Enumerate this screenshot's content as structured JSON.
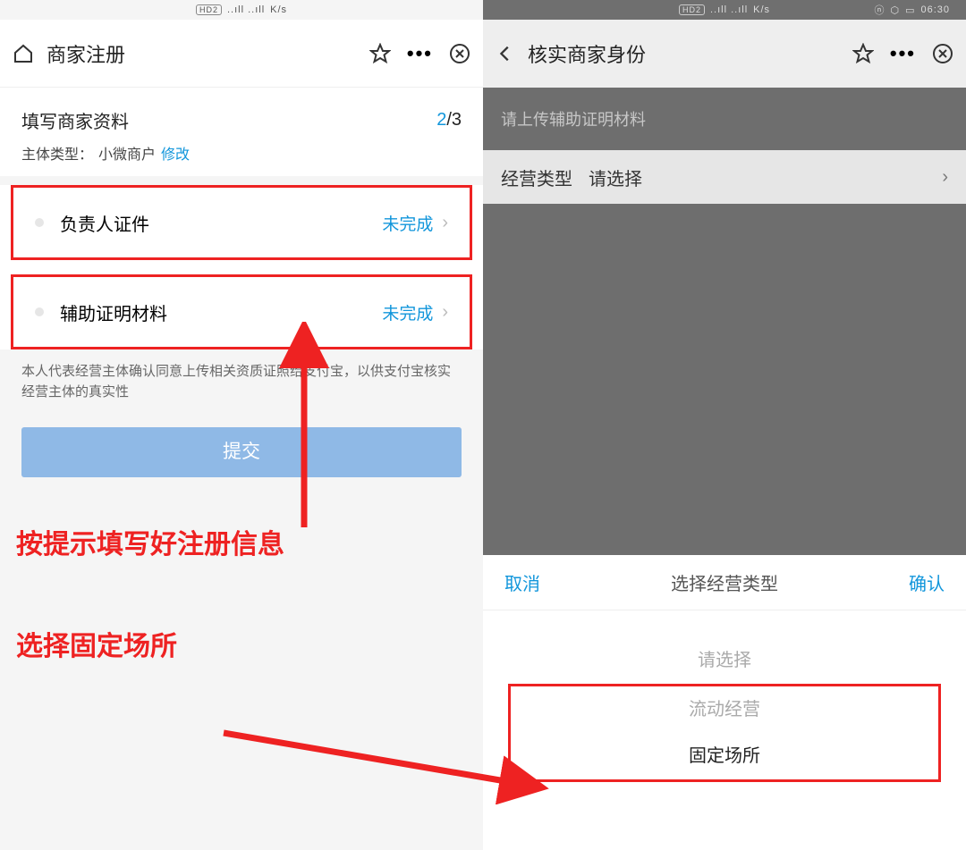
{
  "left": {
    "status": {
      "hd": "HD2",
      "signal": "",
      "speed": "K/s"
    },
    "titlebar": {
      "title": "商家注册"
    },
    "section": {
      "title": "填写商家资料",
      "progress_current": "2",
      "progress_total": "/3",
      "subtitle_prefix": "主体类型：",
      "subtitle_value": "小微商户",
      "modify": "修改"
    },
    "rows": [
      {
        "label": "负责人证件",
        "status": "未完成"
      },
      {
        "label": "辅助证明材料",
        "status": "未完成"
      }
    ],
    "disclaimer": "本人代表经营主体确认同意上传相关资质证照给支付宝，以供支付宝核实经营主体的真实性",
    "submit": "提交",
    "annotation1": "按提示填写好注册信息",
    "annotation2": "选择固定场所"
  },
  "right": {
    "status": {
      "hd": "HD2",
      "speed": "K/s",
      "time": "06:30"
    },
    "titlebar": {
      "title": "核实商家身份"
    },
    "hint": "请上传辅助证明材料",
    "select_label": "经营类型",
    "select_placeholder": "请选择",
    "sheet": {
      "cancel": "取消",
      "title": "选择经营类型",
      "confirm": "确认",
      "options": {
        "placeholder": "请选择",
        "flow": "流动经营",
        "fixed": "固定场所"
      }
    }
  }
}
